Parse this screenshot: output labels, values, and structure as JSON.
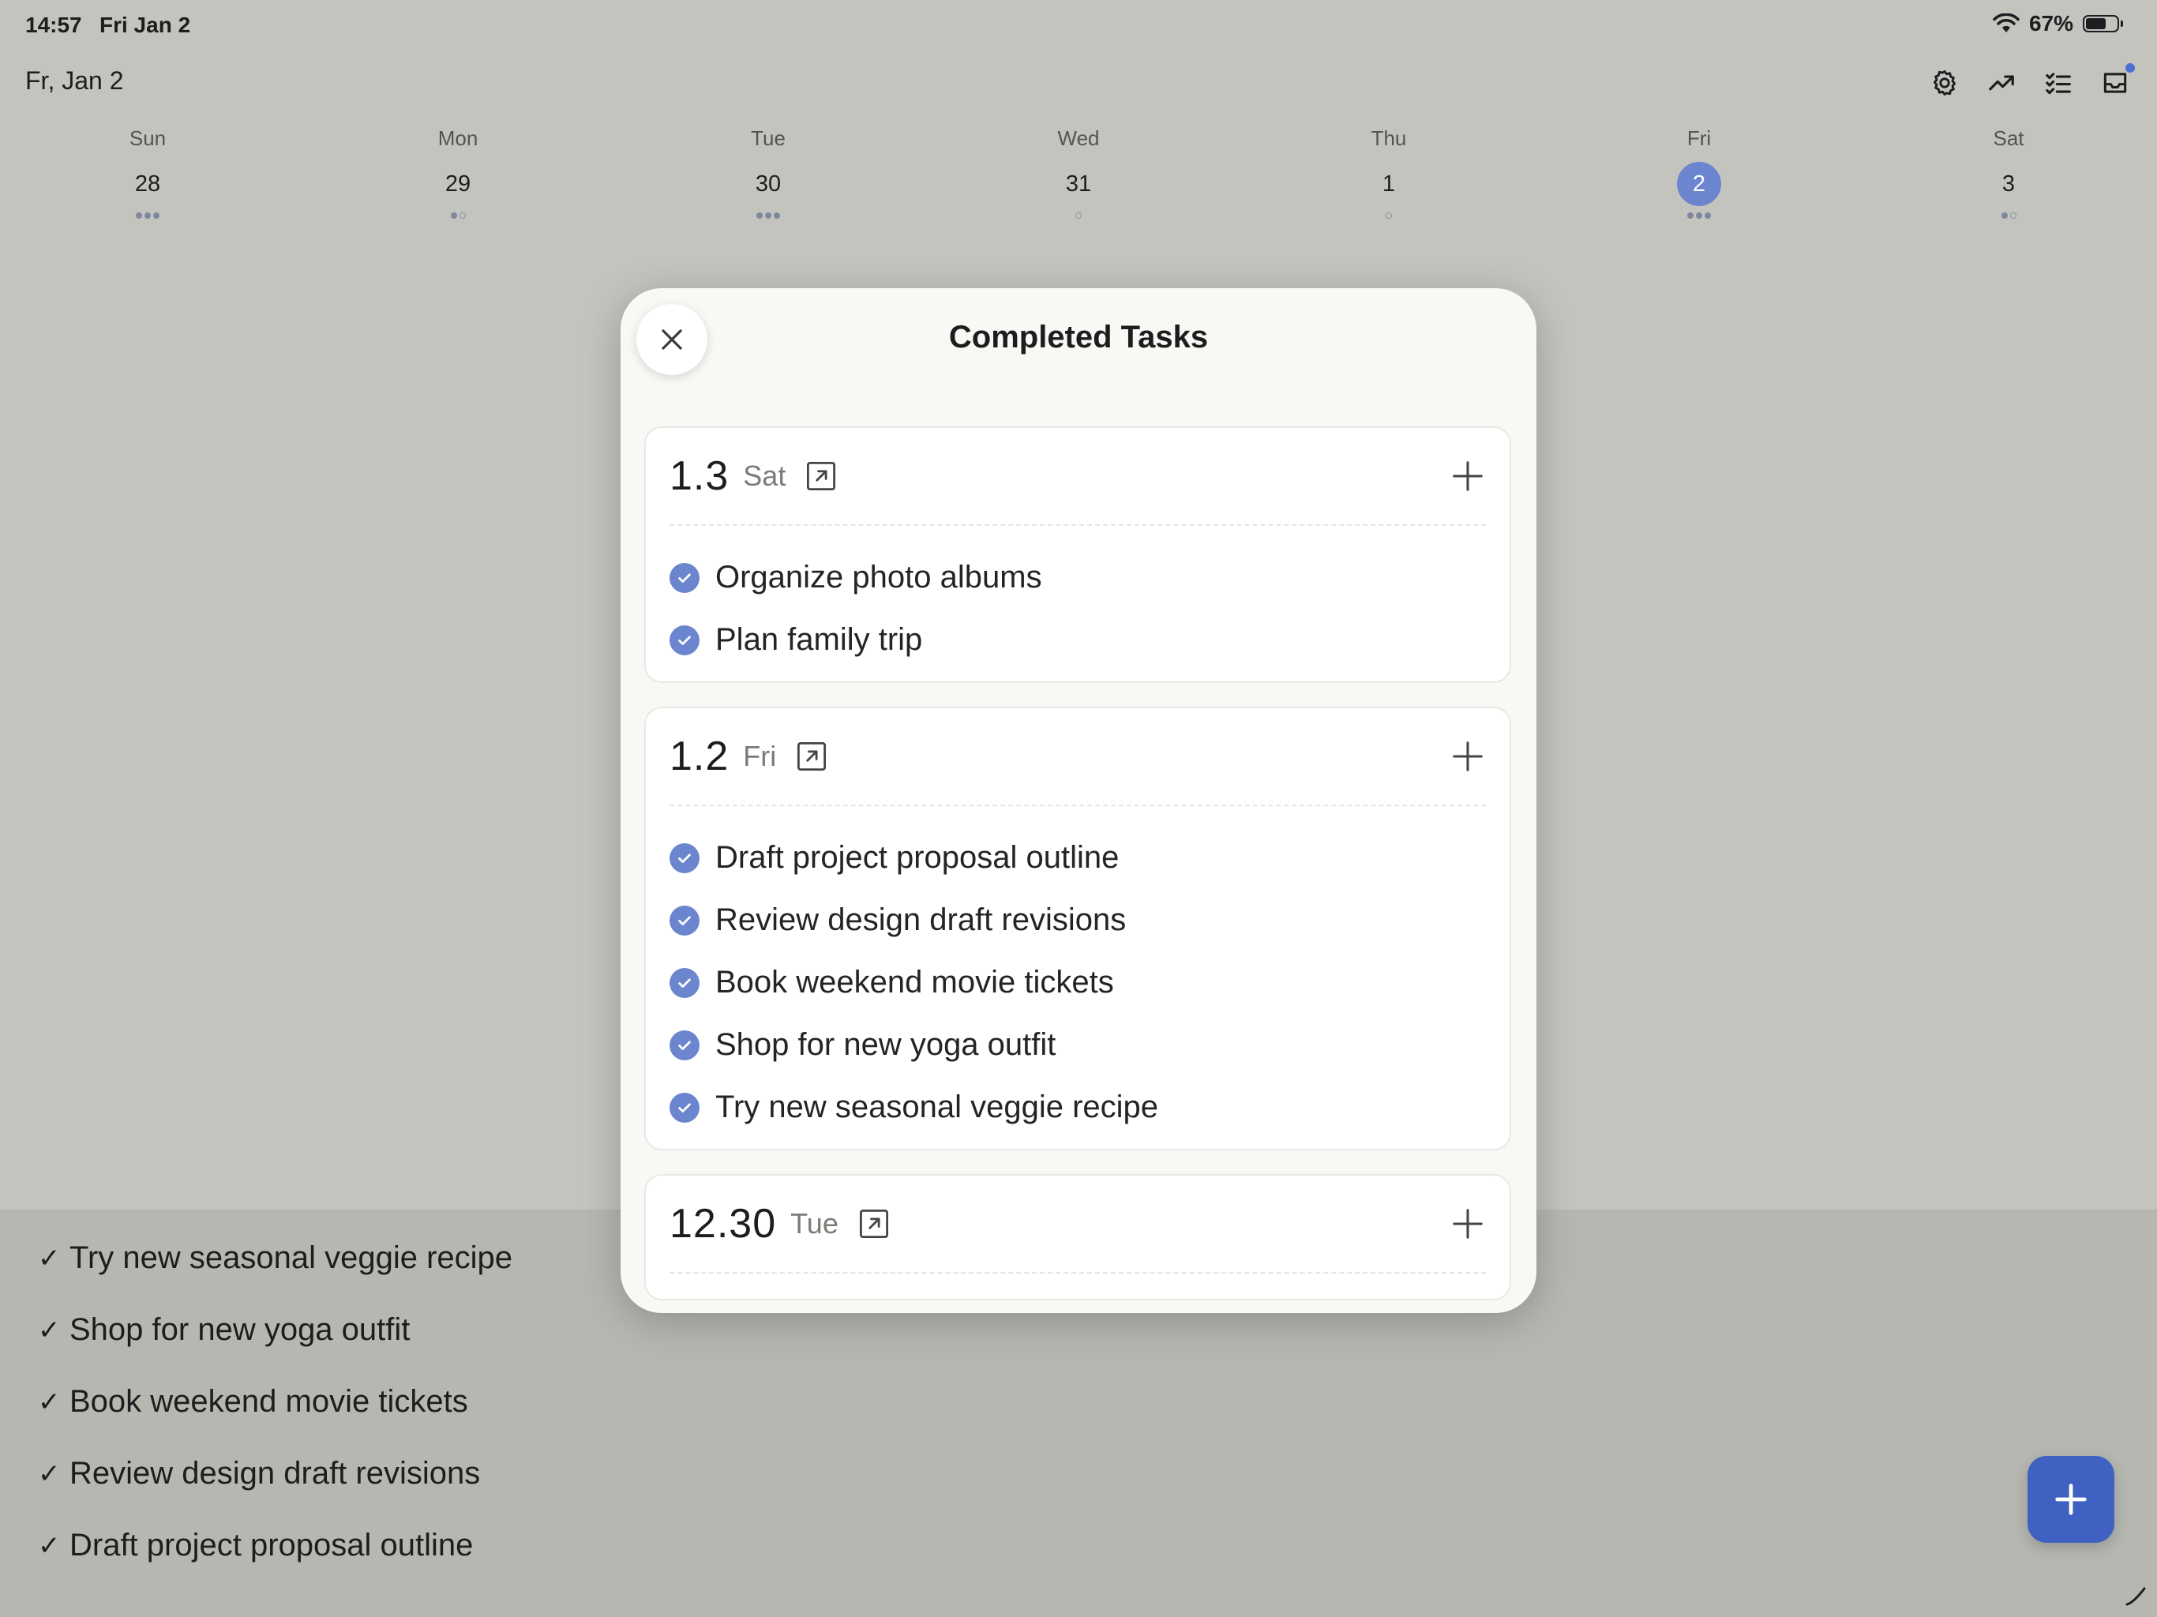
{
  "status_bar": {
    "time": "14:57",
    "date": "Fri Jan 2",
    "battery": "67%",
    "battery_level": 0.67
  },
  "header": {
    "date": "Fr, Jan 2"
  },
  "toolbar": {
    "icons": [
      "gear-icon",
      "trend-up-icon",
      "checklist-icon",
      "inbox-icon"
    ]
  },
  "week": [
    {
      "name": "Sun",
      "num": "28",
      "dots": [
        "filled",
        "filled",
        "filled"
      ],
      "selected": false
    },
    {
      "name": "Mon",
      "num": "29",
      "dots": [
        "filled",
        "empty"
      ],
      "selected": false
    },
    {
      "name": "Tue",
      "num": "30",
      "dots": [
        "filled",
        "filled",
        "filled"
      ],
      "selected": false
    },
    {
      "name": "Wed",
      "num": "31",
      "dots": [
        "empty"
      ],
      "selected": false
    },
    {
      "name": "Thu",
      "num": "1",
      "dots": [
        "empty"
      ],
      "selected": false
    },
    {
      "name": "Fri",
      "num": "2",
      "dots": [
        "filled",
        "filled",
        "filled"
      ],
      "selected": true
    },
    {
      "name": "Sat",
      "num": "3",
      "dots": [
        "filled",
        "empty"
      ],
      "selected": false
    }
  ],
  "bottom_list": {
    "check_glyph": "✓",
    "items": [
      "Try new seasonal veggie recipe",
      "Shop for new yoga outfit",
      "Book weekend movie tickets",
      "Review design draft revisions",
      "Draft project proposal outline"
    ]
  },
  "modal": {
    "title": "Completed Tasks",
    "groups": [
      {
        "date": "1.3",
        "weekday": "Sat",
        "tasks": [
          "Organize photo albums",
          "Plan family trip"
        ]
      },
      {
        "date": "1.2",
        "weekday": "Fri",
        "tasks": [
          "Draft project proposal outline",
          "Review design draft revisions",
          "Book weekend movie tickets",
          "Shop for new yoga outfit",
          "Try new seasonal veggie recipe"
        ]
      },
      {
        "date": "12.30",
        "weekday": "Tue",
        "tasks": []
      }
    ]
  },
  "colors": {
    "accent": "#6c85cf",
    "fab": "#3f62c2",
    "background": "#c3c4be",
    "modal": "#f8f8f4"
  }
}
